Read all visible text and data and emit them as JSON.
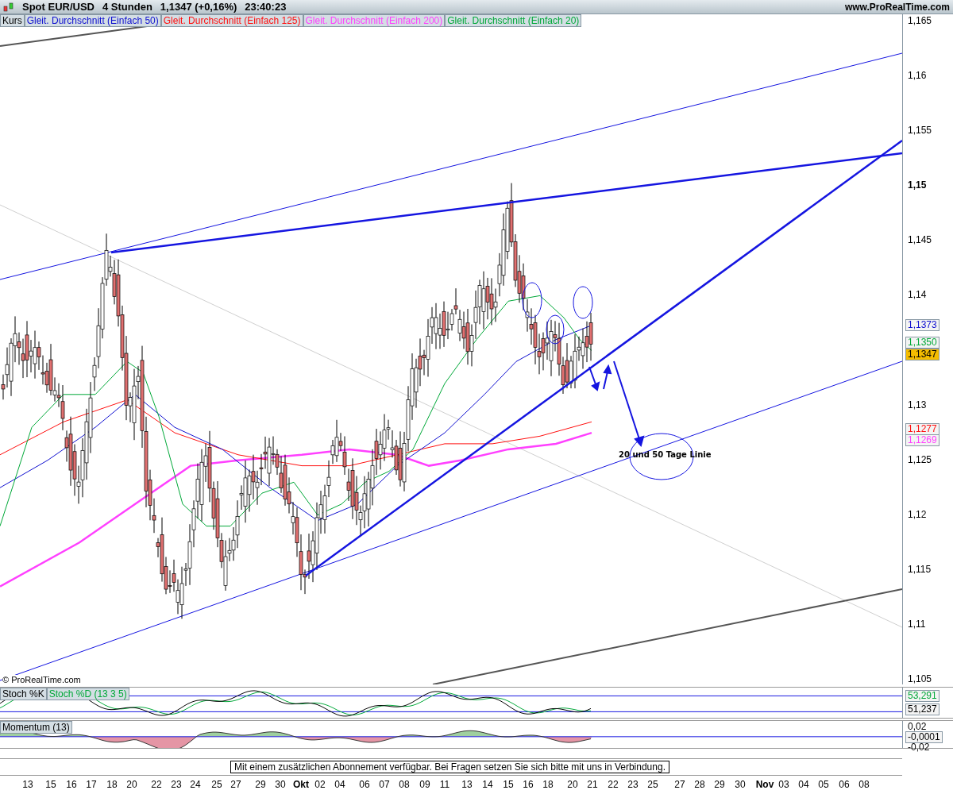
{
  "header": {
    "symbol": "Spot EUR/USD",
    "timeframe": "4 Stunden",
    "quote": "1,1347 (+0,16%)",
    "time": "23:40:23",
    "site": "www.ProRealTime.com"
  },
  "legend": [
    {
      "label": "Kurs",
      "color": "#000000"
    },
    {
      "label": "Gleit. Durchschnitt (Einfach 50)",
      "color": "#1010d0"
    },
    {
      "label": "Gleit. Durchschnitt (Einfach 125)",
      "color": "#ff1010"
    },
    {
      "label": "Gleit. Durchschnitt (Einfach 200)",
      "color": "#ff40ff"
    },
    {
      "label": "Gleit. Durchschnitt (Einfach 20)",
      "color": "#00a838"
    }
  ],
  "y_ticks": [
    {
      "label": "1,165",
      "emphasized": false
    },
    {
      "label": "1,16",
      "emphasized": false
    },
    {
      "label": "1,155",
      "emphasized": false
    },
    {
      "label": "1,15",
      "emphasized": true
    },
    {
      "label": "1,145",
      "emphasized": false
    },
    {
      "label": "1,14",
      "emphasized": false
    },
    {
      "label": "1,13",
      "emphasized": false
    },
    {
      "label": "1,125",
      "emphasized": false
    },
    {
      "label": "1,12",
      "emphasized": false
    },
    {
      "label": "1,115",
      "emphasized": false
    },
    {
      "label": "1,11",
      "emphasized": false
    },
    {
      "label": "1,105",
      "emphasized": false
    }
  ],
  "price_tags": [
    {
      "label": "1,1373",
      "color": "#1010d0",
      "kind": "average"
    },
    {
      "label": "1,1350",
      "color": "#00a838",
      "kind": "average"
    },
    {
      "label": "1,1347",
      "color": "#f5bd00",
      "kind": "last_price"
    },
    {
      "label": "1,1277",
      "color": "#ff1010",
      "kind": "average"
    },
    {
      "label": "1,1269",
      "color": "#ff40ff",
      "kind": "average"
    }
  ],
  "annotation": "20 und 50 Tage Linie",
  "copyright": "© ProRealTime.com",
  "stochastic": {
    "labels": [
      {
        "label": "Stoch %K",
        "color": "#000000"
      },
      {
        "label": "Stoch %D (13 3 5)",
        "color": "#00a838"
      }
    ],
    "tags": [
      {
        "label": "53,291",
        "color": "#00a838"
      },
      {
        "label": "51,237",
        "color": "#000000"
      }
    ]
  },
  "momentum": {
    "label": "Momentum (13)",
    "ticks": [
      "0,02",
      "-0,02"
    ],
    "tag": "-0,0001"
  },
  "notice": "Mit einem zusätzlichen Abonnement verfügbar. Bei Fragen setzen Sie sich bitte mit uns in Verbindung.",
  "x_ticks": [
    {
      "label": "13",
      "kind": "day"
    },
    {
      "label": "15",
      "kind": "day"
    },
    {
      "label": "16",
      "kind": "day"
    },
    {
      "label": "17",
      "kind": "day"
    },
    {
      "label": "18",
      "kind": "day"
    },
    {
      "label": "20",
      "kind": "day"
    },
    {
      "label": "22",
      "kind": "day"
    },
    {
      "label": "23",
      "kind": "day"
    },
    {
      "label": "24",
      "kind": "day"
    },
    {
      "label": "25",
      "kind": "day"
    },
    {
      "label": "27",
      "kind": "day"
    },
    {
      "label": "29",
      "kind": "day"
    },
    {
      "label": "30",
      "kind": "day"
    },
    {
      "label": "Okt",
      "kind": "month"
    },
    {
      "label": "02",
      "kind": "day"
    },
    {
      "label": "04",
      "kind": "day"
    },
    {
      "label": "06",
      "kind": "day"
    },
    {
      "label": "07",
      "kind": "day"
    },
    {
      "label": "08",
      "kind": "day"
    },
    {
      "label": "09",
      "kind": "day"
    },
    {
      "label": "11",
      "kind": "day"
    },
    {
      "label": "13",
      "kind": "day"
    },
    {
      "label": "14",
      "kind": "day"
    },
    {
      "label": "15",
      "kind": "day"
    },
    {
      "label": "16",
      "kind": "day"
    },
    {
      "label": "18",
      "kind": "day"
    },
    {
      "label": "20",
      "kind": "day"
    },
    {
      "label": "21",
      "kind": "day"
    },
    {
      "label": "22",
      "kind": "day"
    },
    {
      "label": "23",
      "kind": "day"
    },
    {
      "label": "25",
      "kind": "day"
    },
    {
      "label": "27",
      "kind": "day"
    },
    {
      "label": "28",
      "kind": "day"
    },
    {
      "label": "29",
      "kind": "day"
    },
    {
      "label": "30",
      "kind": "day"
    },
    {
      "label": "Nov",
      "kind": "month"
    },
    {
      "label": "03",
      "kind": "day"
    },
    {
      "label": "04",
      "kind": "day"
    },
    {
      "label": "05",
      "kind": "day"
    },
    {
      "label": "06",
      "kind": "day"
    },
    {
      "label": "08",
      "kind": "day"
    }
  ]
}
